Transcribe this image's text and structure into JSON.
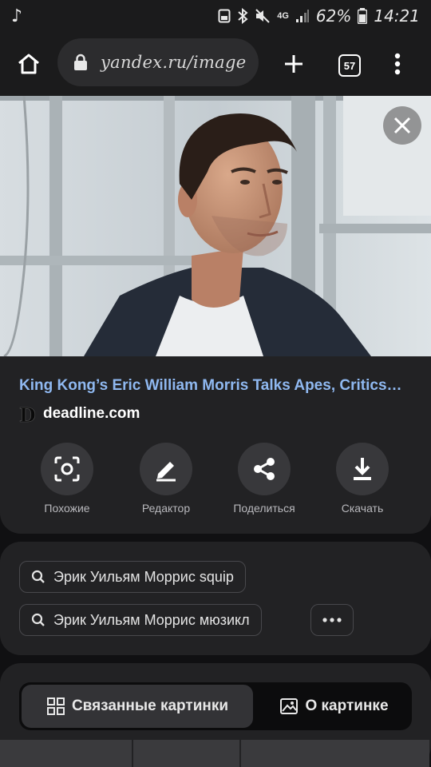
{
  "status_bar": {
    "music_icon": "music-note-icon",
    "battery_percent": "62%",
    "time": "14:21",
    "network": "4G",
    "icons": [
      "save-icon",
      "bluetooth-icon",
      "mute-icon",
      "signal-icon",
      "battery-icon"
    ]
  },
  "toolbar": {
    "url": "yandex.ru/image",
    "tab_count": "57",
    "icons": [
      "home-icon",
      "lock-icon",
      "plus-icon",
      "tabs-icon",
      "more-vertical-icon"
    ]
  },
  "image": {
    "close_icon": "close-icon"
  },
  "result": {
    "title": "King Kong’s Eric William Morris Talks Apes, Critics…",
    "source_logo": "D",
    "source": "deadline.com"
  },
  "actions": [
    {
      "label": "Похожие",
      "icon": "camera-search-icon"
    },
    {
      "label": "Редактор",
      "icon": "pencil-icon"
    },
    {
      "label": "Поделиться",
      "icon": "share-icon"
    },
    {
      "label": "Скачать",
      "icon": "download-icon"
    }
  ],
  "suggestions": [
    {
      "label": "Эрик Уильям Моррис squip",
      "icon": "search-icon"
    },
    {
      "label": "Эрик Уильям Моррис мюзикл",
      "icon": "search-icon"
    }
  ],
  "more_icon": "more-horizontal-icon",
  "tabs": [
    {
      "label": "Связанные картинки",
      "icon": "grid-icon",
      "active": true
    },
    {
      "label": "О картинке",
      "icon": "image-icon",
      "active": false
    }
  ],
  "colors": {
    "background": "#101012",
    "card": "#222224",
    "link": "#8fb8f0",
    "action_circle": "#38383b"
  }
}
